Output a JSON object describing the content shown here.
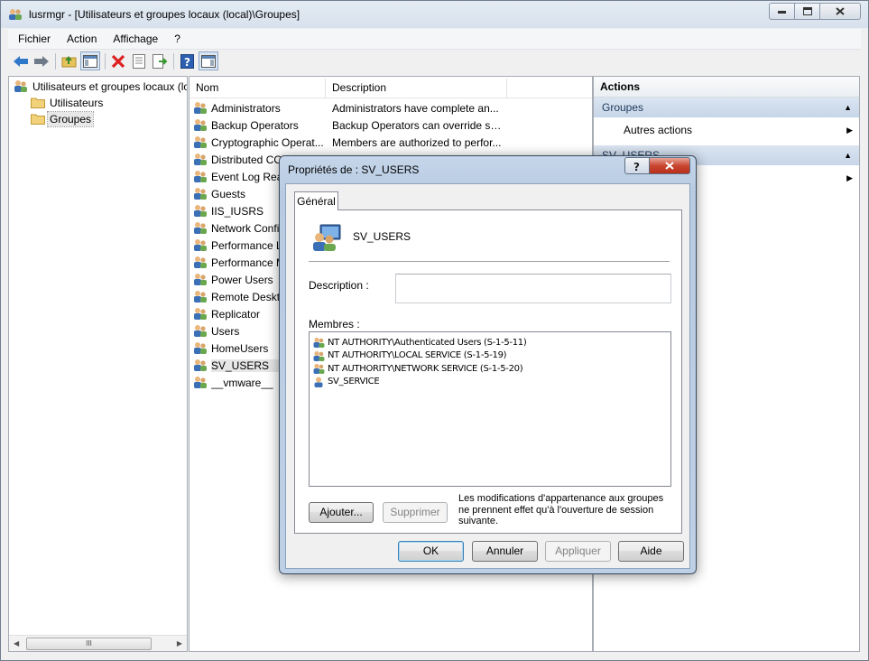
{
  "window": {
    "title": "lusrmgr - [Utilisateurs et groupes locaux (local)\\Groupes]"
  },
  "menu": [
    "Fichier",
    "Action",
    "Affichage",
    "?"
  ],
  "tree": {
    "root": "Utilisateurs et groupes locaux (lo",
    "children": [
      "Utilisateurs",
      "Groupes"
    ],
    "scroll_thumb": "III"
  },
  "list": {
    "columns": {
      "name": "Nom",
      "description": "Description"
    },
    "rows": [
      {
        "name": "Administrators",
        "description": "Administrators have complete an..."
      },
      {
        "name": "Backup Operators",
        "description": "Backup Operators can override se..."
      },
      {
        "name": "Cryptographic Operat...",
        "description": "Members are authorized to perfor..."
      },
      {
        "name": "Distributed COM U",
        "description": ""
      },
      {
        "name": "Event Log Read",
        "description": ""
      },
      {
        "name": "Guests",
        "description": ""
      },
      {
        "name": "IIS_IUSRS",
        "description": ""
      },
      {
        "name": "Network Confi",
        "description": ""
      },
      {
        "name": "Performance L",
        "description": ""
      },
      {
        "name": "Performance M",
        "description": ""
      },
      {
        "name": "Power Users",
        "description": ""
      },
      {
        "name": "Remote Deskto",
        "description": ""
      },
      {
        "name": "Replicator",
        "description": ""
      },
      {
        "name": "Users",
        "description": ""
      },
      {
        "name": "HomeUsers",
        "description": ""
      },
      {
        "name": "SV_USERS",
        "description": ""
      },
      {
        "name": "__vmware__",
        "description": ""
      }
    ]
  },
  "actions": {
    "title": "Actions",
    "section1": "Groupes",
    "item1": "Autres actions",
    "section2": "SV_USERS"
  },
  "dialog": {
    "title": "Propriétés de : SV_USERS",
    "tab": "Général",
    "group_name": "SV_USERS",
    "description_label": "Description :",
    "description_value": "",
    "members_label": "Membres :",
    "members": [
      "NT AUTHORITY\\Authenticated Users (S-1-5-11)",
      "NT AUTHORITY\\LOCAL SERVICE (S-1-5-19)",
      "NT AUTHORITY\\NETWORK SERVICE (S-1-5-20)",
      "SV_SERVICE"
    ],
    "add_button": "Ajouter...",
    "remove_button": "Supprimer",
    "note": "Les modifications d'appartenance aux groupes ne prennent effet qu'à l'ouverture de session suivante.",
    "ok": "OK",
    "cancel": "Annuler",
    "apply": "Appliquer",
    "help": "Aide"
  }
}
